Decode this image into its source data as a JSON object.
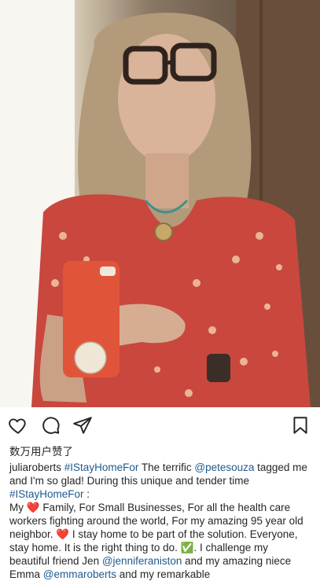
{
  "post": {
    "username": "juliaroberts",
    "likes_label": "数万用户赞了",
    "caption_line1": {
      "hashtag": "#IStayHomeFor",
      "text1": " The terrific ",
      "mention": "@petesouza",
      "text2": " tagged me and I'm so glad! During this unique and tender time ",
      "hashtag2": "#IStayHomeFor",
      "text3": " :"
    },
    "caption_body": {
      "my": "My ",
      "heart1": "❤️",
      "part1": " Family, For Small Businesses, For all the health care workers fighting around the world, For my amazing 95 year old neighbor. ",
      "heart2": "❤️",
      "part2": " I stay home to be part of the solution. Everyone, stay home. It is the right thing to do. ",
      "check": "✅",
      "part3": ". I challenge my beautiful friend Jen ",
      "mention_jen": "@jenniferaniston",
      "part4": " and my amazing niece Emma ",
      "mention_emma": "@emmaroberts",
      "part5": " and my remarkable"
    }
  },
  "icons": {
    "like": "heart-outline-icon",
    "comment": "speech-bubble-icon",
    "share": "paper-plane-icon",
    "save": "bookmark-icon"
  },
  "colors": {
    "link": "#1f5a8e",
    "text": "#262626",
    "phone_case": "#e0553a"
  }
}
